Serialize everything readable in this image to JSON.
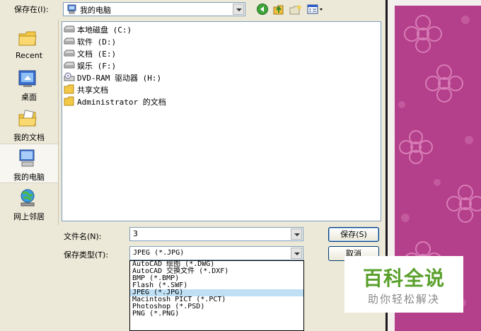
{
  "save_in": {
    "label": "保存在(I):",
    "value": "我的电脑"
  },
  "places": [
    {
      "label": "Recent",
      "icon": "recent-folder-icon"
    },
    {
      "label": "桌面",
      "icon": "desktop-icon"
    },
    {
      "label": "我的文档",
      "icon": "my-documents-icon"
    },
    {
      "label": "我的电脑",
      "icon": "my-computer-icon"
    },
    {
      "label": "网上邻居",
      "icon": "network-places-icon"
    }
  ],
  "files": [
    {
      "name": "本地磁盘 (C:)",
      "icon": "hard-drive-icon"
    },
    {
      "name": "软件 (D:)",
      "icon": "hard-drive-icon"
    },
    {
      "name": "文档 (E:)",
      "icon": "hard-drive-icon"
    },
    {
      "name": "娱乐 (F:)",
      "icon": "hard-drive-icon"
    },
    {
      "name": "DVD-RAM 驱动器 (H:)",
      "icon": "dvd-drive-icon"
    },
    {
      "name": "共享文档",
      "icon": "folder-icon"
    },
    {
      "name": "Administrator 的文档",
      "icon": "folder-icon"
    }
  ],
  "file_name": {
    "label": "文件名(N):",
    "value": "3"
  },
  "file_type": {
    "label": "保存类型(T):",
    "value": "JPEG (*.JPG)"
  },
  "buttons": {
    "save": "保存(S)",
    "cancel": "取消"
  },
  "type_options": [
    "AutoCAD 绘图 (*.DWG)",
    "AutoCAD 交换文件 (*.DXF)",
    "BMP (*.BMP)",
    "Flash (*.SWF)",
    "JPEG (*.JPG)",
    "Macintosh PICT (*.PCT)",
    "Photoshop (*.PSD)",
    "PNG (*.PNG)"
  ],
  "selected_type_index": 4,
  "watermark": {
    "title": "百科全说",
    "subtitle": "助你轻松解决"
  },
  "colors": {
    "accent_bg": "#b43f8a",
    "selection": "#bfe0f4",
    "watermark_green": "#5aa02c"
  }
}
